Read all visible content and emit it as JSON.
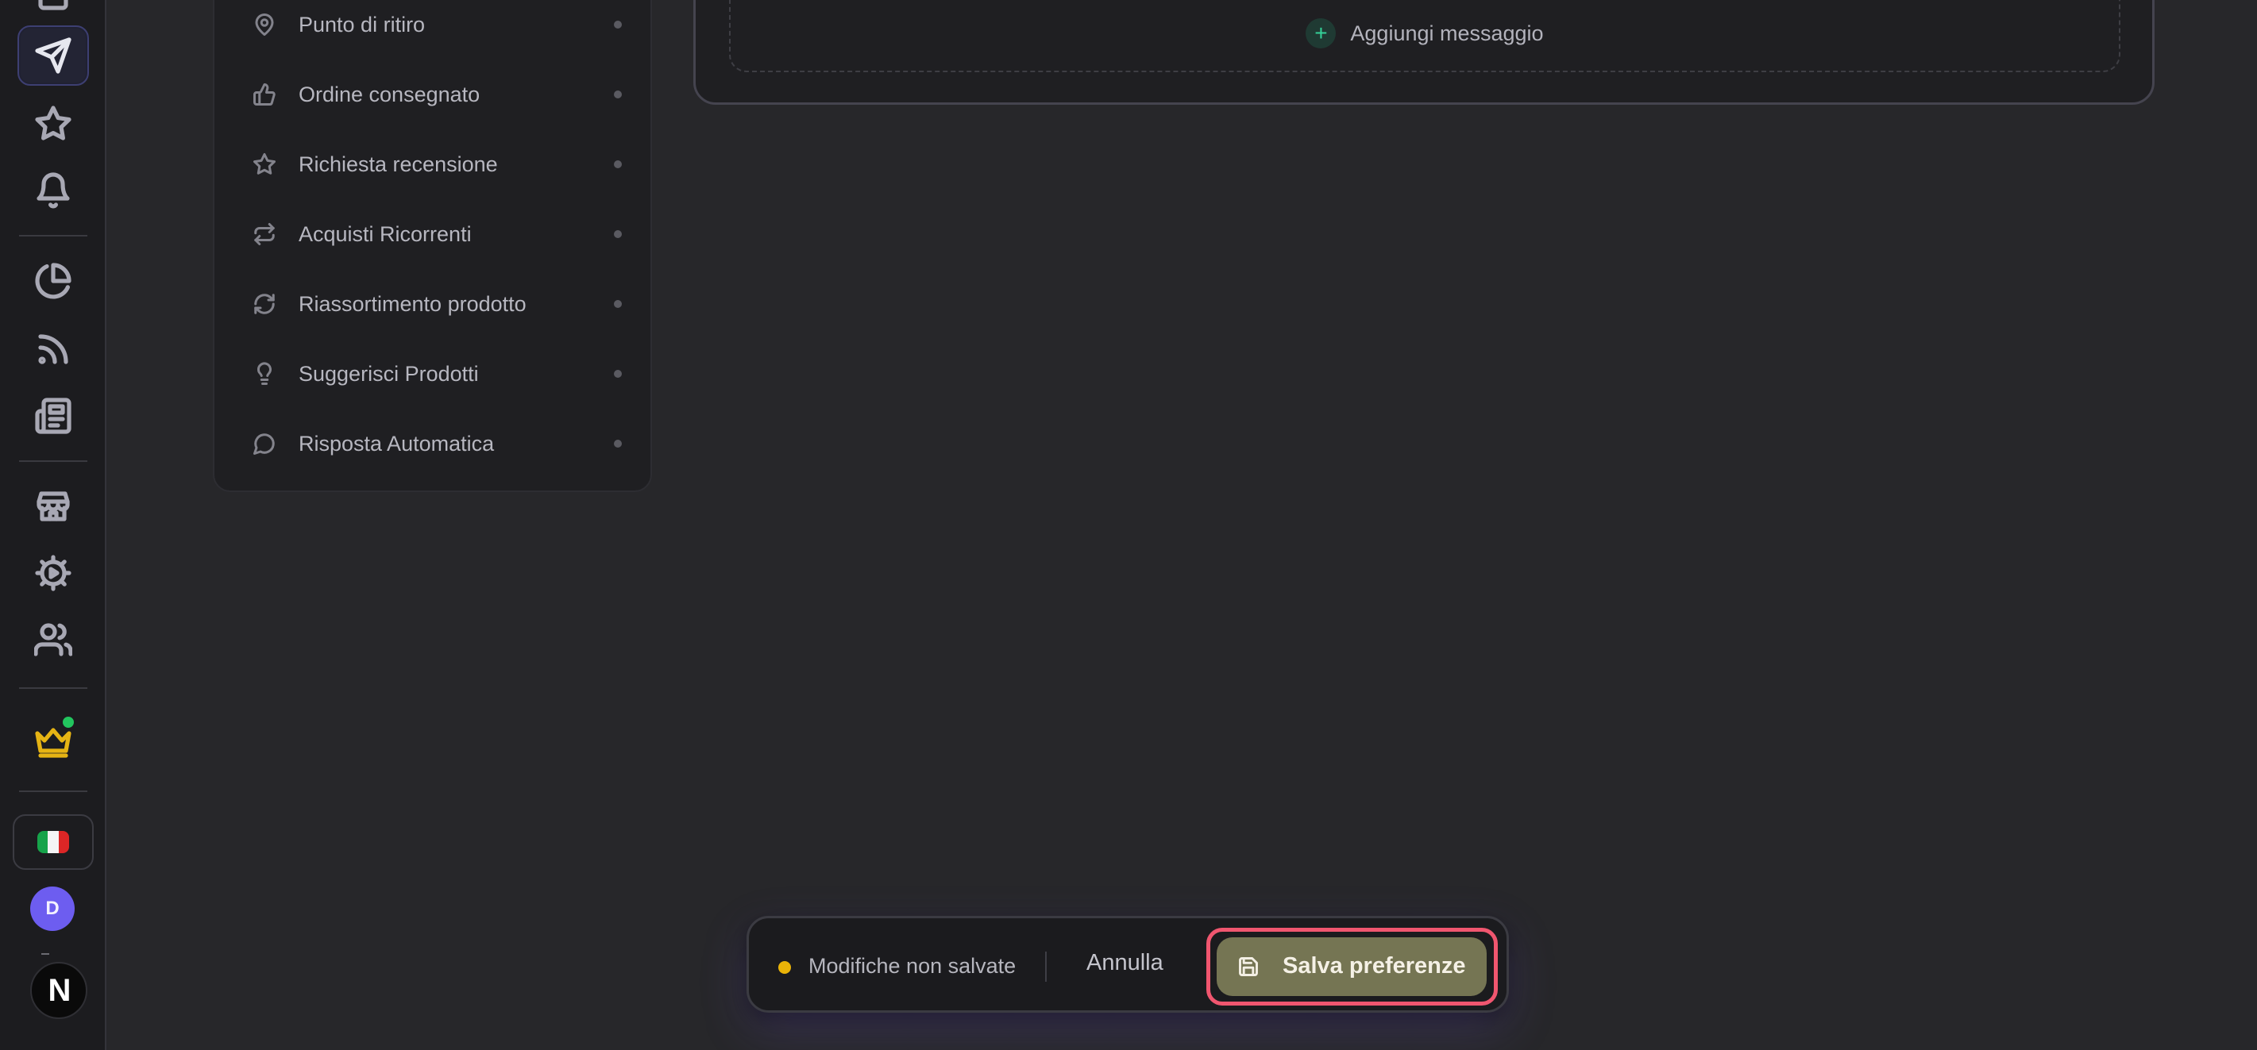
{
  "sidebar": {
    "nav_icons": [
      "inbox-icon",
      "send-icon",
      "star-icon",
      "bell-icon",
      "pie-chart-icon",
      "rss-icon",
      "newspaper-icon",
      "store-icon",
      "settings-play-icon",
      "users-icon",
      "crown-icon"
    ],
    "active_item": "send-icon",
    "language_flag": "italy-flag-icon",
    "user_avatar_initial": "D",
    "brand_logo_letter": "N",
    "colors": {
      "active_border": "#3d3f72",
      "crown": "#e6b414",
      "status_online": "#22c55e",
      "avatar_bg": "#6d5df0"
    }
  },
  "events": {
    "items": [
      {
        "label": "Punto di ritiro",
        "icon": "map-pin-icon"
      },
      {
        "label": "Ordine consegnato",
        "icon": "thumbs-up-icon"
      },
      {
        "label": "Richiesta recensione",
        "icon": "star-icon"
      },
      {
        "label": "Acquisti Ricorrenti",
        "icon": "repeat-icon"
      },
      {
        "label": "Riassortimento prodotto",
        "icon": "refresh-icon"
      },
      {
        "label": "Suggerisci Prodotti",
        "icon": "lightbulb-icon"
      },
      {
        "label": "Risposta Automatica",
        "icon": "message-circle-icon"
      }
    ]
  },
  "messages": {
    "add_label": "Aggiungi messaggio",
    "add_icon": "plus-icon"
  },
  "save_bar": {
    "status_text": "Modifiche non salvate",
    "cancel_label": "Annulla",
    "save_label": "Salva preferenze",
    "save_icon": "save-icon",
    "colors": {
      "status_dot": "#eab308",
      "save_bg": "#757553",
      "highlight_ring": "#f0566f"
    }
  }
}
